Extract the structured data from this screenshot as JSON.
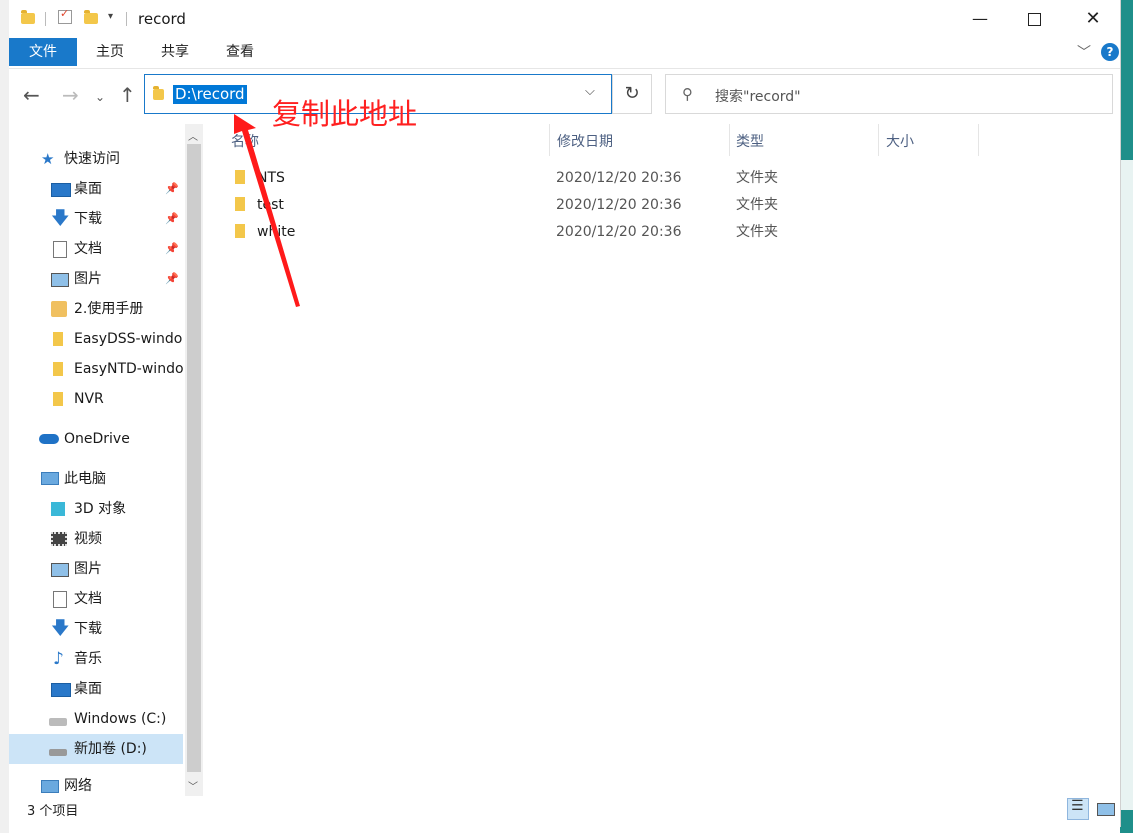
{
  "window": {
    "title": "record"
  },
  "ribbon": {
    "tabs": [
      "文件",
      "主页",
      "共享",
      "查看"
    ],
    "help": "?"
  },
  "address": {
    "path": "D:\\record",
    "search_placeholder": "搜索\"record\""
  },
  "nav": {
    "quick_access": "快速访问",
    "items": [
      {
        "label": "桌面",
        "icon": "desktop-icon",
        "pinned": true
      },
      {
        "label": "下载",
        "icon": "download-icon",
        "pinned": true
      },
      {
        "label": "文档",
        "icon": "document-icon",
        "pinned": true
      },
      {
        "label": "图片",
        "icon": "pictures-icon",
        "pinned": true
      },
      {
        "label": "2.使用手册",
        "icon": "folder-icon",
        "pinned": false
      },
      {
        "label": "EasyDSS-windo",
        "icon": "folder-icon",
        "pinned": false
      },
      {
        "label": "EasyNTD-windo",
        "icon": "folder-icon",
        "pinned": false
      },
      {
        "label": "NVR",
        "icon": "folder-icon",
        "pinned": false
      }
    ],
    "onedrive": "OneDrive",
    "this_pc": "此电脑",
    "pc_items": [
      {
        "label": "3D 对象",
        "icon": "3d-objects-icon"
      },
      {
        "label": "视频",
        "icon": "video-icon"
      },
      {
        "label": "图片",
        "icon": "pictures-icon"
      },
      {
        "label": "文档",
        "icon": "document-icon"
      },
      {
        "label": "下载",
        "icon": "download-icon"
      },
      {
        "label": "音乐",
        "icon": "music-icon"
      },
      {
        "label": "桌面",
        "icon": "desktop-icon"
      },
      {
        "label": "Windows (C:)",
        "icon": "drive-c-icon"
      },
      {
        "label": "新加卷 (D:)",
        "icon": "drive-d-icon"
      }
    ],
    "network": "网络"
  },
  "columns": [
    "名称",
    "修改日期",
    "类型",
    "大小"
  ],
  "files": [
    {
      "name": "NTS",
      "date": "2020/12/20 20:36",
      "type": "文件夹"
    },
    {
      "name": "test",
      "date": "2020/12/20 20:36",
      "type": "文件夹"
    },
    {
      "name": "white",
      "date": "2020/12/20 20:36",
      "type": "文件夹"
    }
  ],
  "status": {
    "count": "3 个项目"
  },
  "annotation": {
    "text": "复制此地址",
    "color": "#ff2020"
  },
  "colors": {
    "accent": "#1979ca",
    "selection": "#0078d7"
  }
}
